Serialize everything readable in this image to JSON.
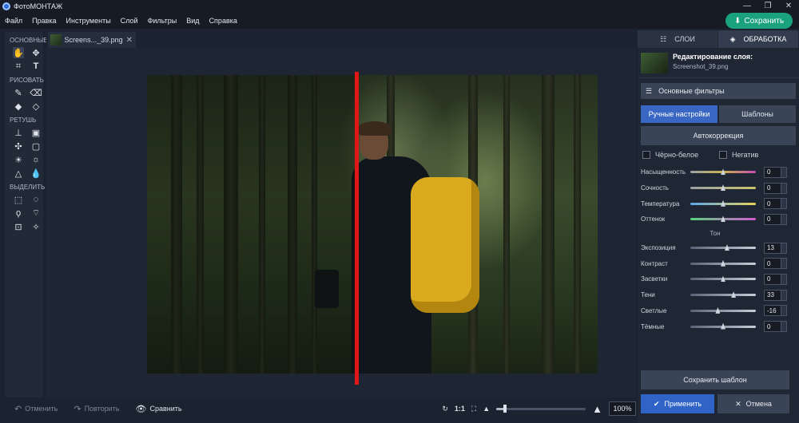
{
  "window": {
    "title": "ФотоМОНТАЖ",
    "controls": [
      "—",
      "❐",
      "✕"
    ]
  },
  "menu": [
    "Файл",
    "Правка",
    "Инструменты",
    "Слой",
    "Фильтры",
    "Вид",
    "Справка"
  ],
  "save_button": "Сохранить",
  "toolbar": {
    "sections": [
      {
        "label": "ОСНОВНЫЕ",
        "tools": [
          [
            "hand-icon",
            "move-icon"
          ],
          [
            "crop-icon",
            "text-icon"
          ]
        ]
      },
      {
        "label": "РИСОВАТЬ",
        "tools": [
          [
            "brush-icon",
            "eraser-icon"
          ],
          [
            "fill-icon",
            "shapes-icon"
          ]
        ]
      },
      {
        "label": "РЕТУШЬ",
        "tools": [
          [
            "stamp-icon",
            "patch-icon"
          ],
          [
            "healing-icon",
            "frame-icon"
          ],
          [
            "dodge-icon",
            "burn-icon"
          ],
          [
            "sharpen-icon",
            "blur-icon"
          ]
        ]
      },
      {
        "label": "ВЫДЕЛИТЬ",
        "tools": [
          [
            "rect-select-icon",
            "ellipse-select-icon"
          ],
          [
            "lasso-icon",
            "poly-lasso-icon"
          ],
          [
            "magic-select-icon",
            "magic-wand-icon"
          ]
        ]
      }
    ]
  },
  "file_tab": {
    "name": "Screens..._39.png"
  },
  "bottom": {
    "undo": "Отменить",
    "redo": "Повторить",
    "compare": "Сравнить",
    "ratio": "1:1",
    "zoom": "100%",
    "zoom_level": 0.1
  },
  "panel": {
    "tab_layers": "СЛОИ",
    "tab_processing": "ОБРАБОТКА",
    "layer_title": "Редактирование слоя:",
    "layer_file": "Screenshot_39.png",
    "filters_button": "Основные фильтры",
    "mode_manual": "Ручные настройки",
    "mode_templates": "Шаблоны",
    "autocorrect": "Автокоррекция",
    "check_bw": "Чёрно-белое",
    "check_negative": "Негатив",
    "tone_group": "Тон",
    "color_sliders": [
      {
        "label": "Насыщенность",
        "value": "0",
        "level": 0.5,
        "track": "saturation"
      },
      {
        "label": "Сочность",
        "value": "0",
        "level": 0.5,
        "track": "vibrance"
      },
      {
        "label": "Температура",
        "value": "0",
        "level": 0.5,
        "track": "temperature"
      },
      {
        "label": "Оттенок",
        "value": "0",
        "level": 0.5,
        "track": "tint"
      }
    ],
    "tone_sliders": [
      {
        "label": "Экспозиция",
        "value": "13",
        "level": 0.56
      },
      {
        "label": "Контраст",
        "value": "0",
        "level": 0.5
      },
      {
        "label": "Засветки",
        "value": "0",
        "level": 0.5
      },
      {
        "label": "Тени",
        "value": "33",
        "level": 0.66
      },
      {
        "label": "Светлые",
        "value": "-16",
        "level": 0.42
      },
      {
        "label": "Тёмные",
        "value": "0",
        "level": 0.5
      }
    ],
    "save_template": "Сохранить шаблон",
    "apply": "Применить",
    "cancel": "Отмена"
  }
}
